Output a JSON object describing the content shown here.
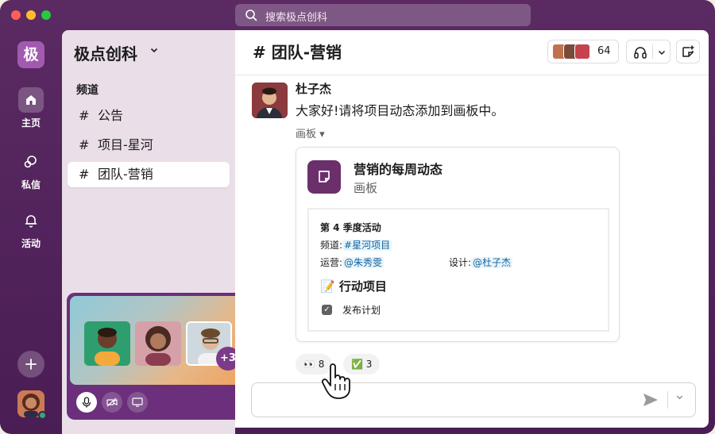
{
  "search": {
    "placeholder": "搜索极点创科"
  },
  "rail": {
    "workspace_initial": "极",
    "items": [
      {
        "label": "主页",
        "icon": "home-icon"
      },
      {
        "label": "私信",
        "icon": "dm-icon"
      },
      {
        "label": "活动",
        "icon": "bell-icon"
      }
    ]
  },
  "sidebar": {
    "workspace_name": "极点创科",
    "section": "频道",
    "channels": [
      {
        "name": "公告"
      },
      {
        "name": "项目-星河"
      },
      {
        "name": "团队-营销",
        "active": true
      }
    ]
  },
  "huddle": {
    "more_count": "+3"
  },
  "header": {
    "channel": "# 团队-营销",
    "member_count": "64"
  },
  "message": {
    "author": "杜子杰",
    "text": "大家好!请将项目动态添加到画板中。",
    "attachment_label": "画板 ▾",
    "canvas": {
      "title": "营销的每周动态",
      "subtitle": "画板",
      "heading": "第 4 季度活动",
      "channel_label": "频道:",
      "channel_mention": "#星河项目",
      "ops_label": "运营:",
      "ops_mention": "@朱秀雯",
      "design_label": "设计:",
      "design_mention": "@杜子杰",
      "actions_title": "行动项目",
      "task": "发布计划"
    }
  },
  "reactions": [
    {
      "emoji": "👀",
      "count": "8"
    },
    {
      "emoji": "✅",
      "count": "3"
    }
  ],
  "colors": {
    "aubergine": "#4a1d55",
    "accent": "#a25ab0",
    "link": "#1264a3"
  }
}
